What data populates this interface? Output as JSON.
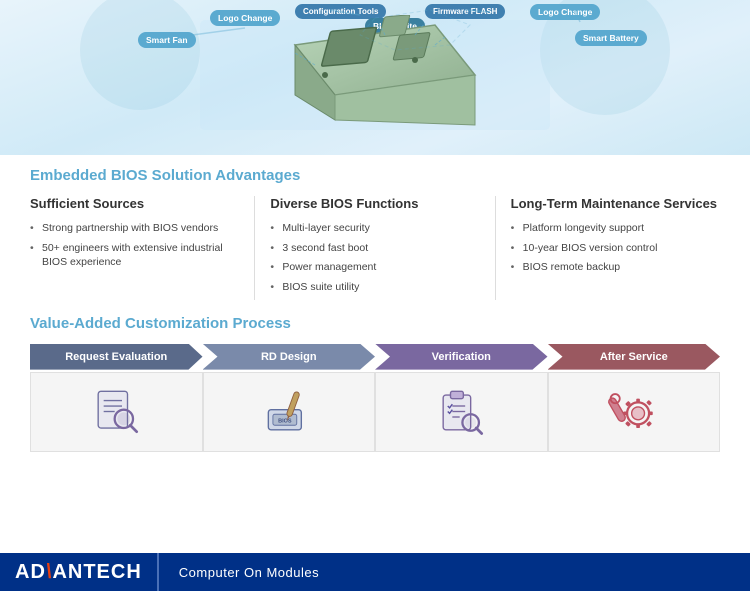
{
  "diagram": {
    "labels": {
      "smart_fan": "Smart Fan",
      "logo_change": "Logo Change",
      "config_tools": "Configuration Tools",
      "bios_suite": "BIOS Suite",
      "firmware_flash": "Firmware FLASH",
      "logo_change2": "Logo Change",
      "smart_battery": "Smart Battery"
    }
  },
  "advantages": {
    "section_title": "Embedded BIOS Solution Advantages",
    "col1": {
      "title": "Sufficient Sources",
      "bullets": [
        "Strong partnership with BIOS vendors",
        "50+ engineers with extensive industrial BIOS experience"
      ]
    },
    "col2": {
      "title": "Diverse BIOS Functions",
      "bullets": [
        "Multi-layer security",
        "3 second fast boot",
        "Power management",
        "BIOS suite utility"
      ]
    },
    "col3": {
      "title": "Long-Term Maintenance Services",
      "bullets": [
        "Platform longevity support",
        "10-year BIOS version control",
        "BIOS remote backup"
      ]
    }
  },
  "process": {
    "section_title": "Value-Added Customization Process",
    "steps": [
      {
        "label": "Request Evaluation",
        "color": "#5a6a8a",
        "icon": "document-search"
      },
      {
        "label": "RD Design",
        "color": "#7a8aaa",
        "icon": "bios-chip"
      },
      {
        "label": "Verification",
        "color": "#7a68a0",
        "icon": "clipboard-check"
      },
      {
        "label": "After Service",
        "color": "#9a5860",
        "icon": "wrench-gear"
      }
    ]
  },
  "footer": {
    "brand_prefix": "AD",
    "brand_accent": "\\",
    "brand_main": "ANTECH",
    "subtitle": "Computer On Modules"
  }
}
